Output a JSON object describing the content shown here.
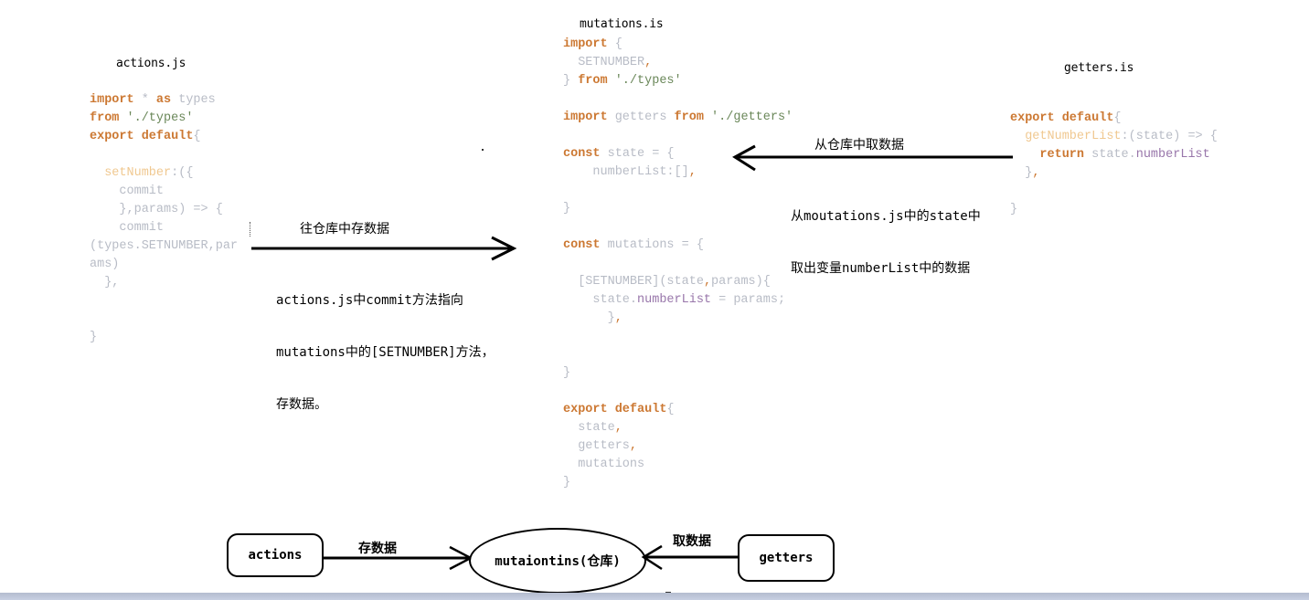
{
  "actions_panel": {
    "title": "actions.js",
    "lines": [
      [
        {
          "t": "import",
          "c": "kw"
        },
        {
          "t": " * ",
          "c": "gray"
        },
        {
          "t": "as",
          "c": "kw"
        },
        {
          "t": " types",
          "c": "gray"
        }
      ],
      [
        {
          "t": "from",
          "c": "kw"
        },
        {
          "t": " './types'",
          "c": "str"
        }
      ],
      [
        {
          "t": "export default",
          "c": "kw"
        },
        {
          "t": "{",
          "c": "gray"
        }
      ],
      [],
      [
        {
          "t": "  setNumber",
          "c": "fn"
        },
        {
          "t": ":({",
          "c": "gray"
        }
      ],
      [
        {
          "t": "    commit",
          "c": "gray"
        }
      ],
      [
        {
          "t": "    },params) => {",
          "c": "gray"
        }
      ],
      [
        {
          "t": "    commit",
          "c": "gray"
        }
      ],
      [
        {
          "t": "(types.SETNUMBER,par",
          "c": "gray"
        }
      ],
      [
        {
          "t": "ams)",
          "c": "gray"
        }
      ],
      [
        {
          "t": "  },",
          "c": "gray"
        }
      ],
      [],
      [],
      [
        {
          "t": "}",
          "c": "gray"
        }
      ]
    ]
  },
  "mutations_panel": {
    "title": "mutations.is",
    "lines": [
      [
        {
          "t": "import",
          "c": "kw"
        },
        {
          "t": " {",
          "c": "gray"
        }
      ],
      [
        {
          "t": "  SETNUMBER",
          "c": "gray"
        },
        {
          "t": ",",
          "c": "punc"
        }
      ],
      [
        {
          "t": "} ",
          "c": "gray"
        },
        {
          "t": "from",
          "c": "kw"
        },
        {
          "t": " './types'",
          "c": "str"
        }
      ],
      [],
      [
        {
          "t": "import",
          "c": "kw"
        },
        {
          "t": " getters ",
          "c": "gray"
        },
        {
          "t": "from",
          "c": "kw"
        },
        {
          "t": " './getters'",
          "c": "str"
        }
      ],
      [],
      [
        {
          "t": "const",
          "c": "kw"
        },
        {
          "t": " state = {",
          "c": "gray"
        }
      ],
      [
        {
          "t": "    numberList:[]",
          "c": "gray"
        },
        {
          "t": ",",
          "c": "punc"
        }
      ],
      [],
      [
        {
          "t": "}",
          "c": "gray"
        }
      ],
      [],
      [
        {
          "t": "const",
          "c": "kw"
        },
        {
          "t": " mutations = {",
          "c": "gray"
        }
      ],
      [],
      [
        {
          "t": "  [SETNUMBER](state",
          "c": "gray"
        },
        {
          "t": ",",
          "c": "punc"
        },
        {
          "t": "params){",
          "c": "gray"
        }
      ],
      [
        {
          "t": "    state.",
          "c": "gray"
        },
        {
          "t": "numberList",
          "c": "prop"
        },
        {
          "t": " = params;",
          "c": "gray"
        }
      ],
      [
        {
          "t": "      }",
          "c": "gray"
        },
        {
          "t": ",",
          "c": "punc"
        }
      ],
      [],
      [],
      [
        {
          "t": "}",
          "c": "gray"
        }
      ],
      [],
      [
        {
          "t": "export default",
          "c": "kw"
        },
        {
          "t": "{",
          "c": "gray"
        }
      ],
      [
        {
          "t": "  state",
          "c": "gray"
        },
        {
          "t": ",",
          "c": "punc"
        }
      ],
      [
        {
          "t": "  getters",
          "c": "gray"
        },
        {
          "t": ",",
          "c": "punc"
        }
      ],
      [
        {
          "t": "  mutations",
          "c": "gray"
        }
      ],
      [
        {
          "t": "}",
          "c": "gray"
        }
      ]
    ]
  },
  "getters_panel": {
    "title": "getters.is",
    "lines": [
      [
        {
          "t": "export default",
          "c": "kw"
        },
        {
          "t": "{",
          "c": "gray"
        }
      ],
      [
        {
          "t": "  getNumberList",
          "c": "fn"
        },
        {
          "t": ":(state) => {",
          "c": "gray"
        }
      ],
      [
        {
          "t": "    ",
          "c": "gray"
        },
        {
          "t": "return",
          "c": "kw"
        },
        {
          "t": " state.",
          "c": "gray"
        },
        {
          "t": "numberList",
          "c": "prop"
        }
      ],
      [
        {
          "t": "  }",
          "c": "gray"
        },
        {
          "t": ",",
          "c": "punc"
        }
      ],
      [],
      [
        {
          "t": "}",
          "c": "gray"
        }
      ]
    ]
  },
  "store_arrow": {
    "label": "往仓库中存数据",
    "note_lines": [
      "actions.js中commit方法指向",
      "mutations中的[SETNUMBER]方法，",
      "存数据。"
    ]
  },
  "fetch_arrow": {
    "label": "从仓库中取数据",
    "note_lines": [
      "从moutations.js中的state中",
      "取出变量numberList中的数据"
    ]
  },
  "flow": {
    "actions_label": "actions",
    "store_label": "存数据",
    "mutations_label": "mutaiontins(仓库)",
    "fetch_label": "取数据",
    "getters_label": "getters"
  }
}
